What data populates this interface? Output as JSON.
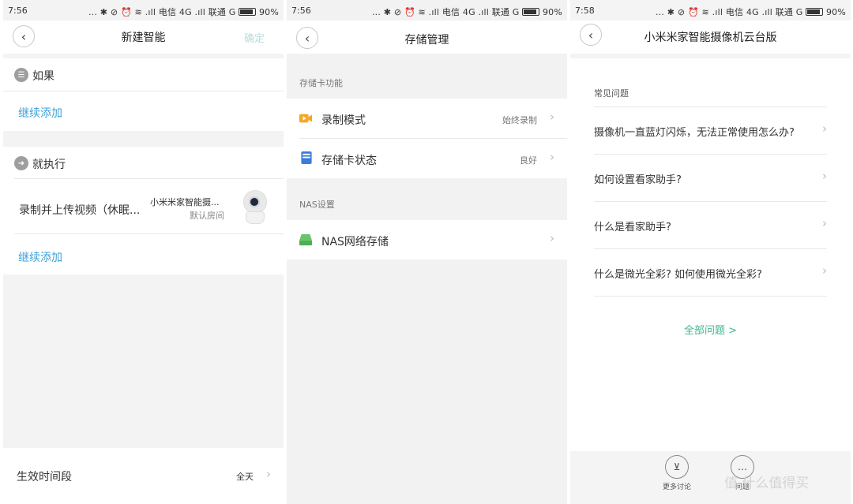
{
  "panel1": {
    "status": {
      "time": "7:56",
      "icons": "... ✱ ⊘ ⏰ ≋ .ıll 电信 4G .ıll 联通 G",
      "battery": "90%"
    },
    "header": {
      "title": "新建智能",
      "confirm_label": "确定"
    },
    "if_section": {
      "label": "如果",
      "add_label": "继续添加"
    },
    "then_section": {
      "label": "就执行",
      "action": {
        "text": "录制并上传视频（休眠...",
        "device_name": "小米米家智能摄...",
        "room": "默认房间"
      },
      "add_label": "继续添加"
    },
    "footer": {
      "label": "生效时间段",
      "value": "全天"
    }
  },
  "panel2": {
    "status": {
      "time": "7:56",
      "icons": "... ✱ ⊘ ⏰ ≋ .ıll 电信 4G .ıll 联通 G",
      "battery": "90%"
    },
    "header": {
      "title": "存储管理"
    },
    "sd_section": {
      "label": "存储卡功能",
      "items": [
        {
          "label": "录制模式",
          "value": "始终录制",
          "icon": "video-record-icon",
          "color": "#f5a623"
        },
        {
          "label": "存储卡状态",
          "value": "良好",
          "icon": "sd-card-icon",
          "color": "#3b7dd8"
        }
      ]
    },
    "nas_section": {
      "label": "NAS设置",
      "items": [
        {
          "label": "NAS网络存储",
          "value": "",
          "icon": "nas-drive-icon",
          "color": "#5cb85c"
        }
      ]
    }
  },
  "panel3": {
    "status": {
      "time": "7:58",
      "icons": "... ✱ ⊘ ⏰ ≋ .ıll 电信 4G .ıll 联通 G",
      "battery": "90%"
    },
    "header": {
      "title": "小米米家智能摄像机云台版"
    },
    "faq": {
      "heading": "常见问题",
      "items": [
        "摄像机一直蓝灯闪烁，无法正常使用怎么办?",
        "如何设置看家助手?",
        "什么是看家助手?",
        "什么是微光全彩? 如何使用微光全彩?"
      ],
      "all_label": "全部问题 >"
    },
    "bottom": {
      "discuss_label": "更多讨论",
      "feedback_label": "问题"
    },
    "watermark": "值 什么值得买"
  }
}
